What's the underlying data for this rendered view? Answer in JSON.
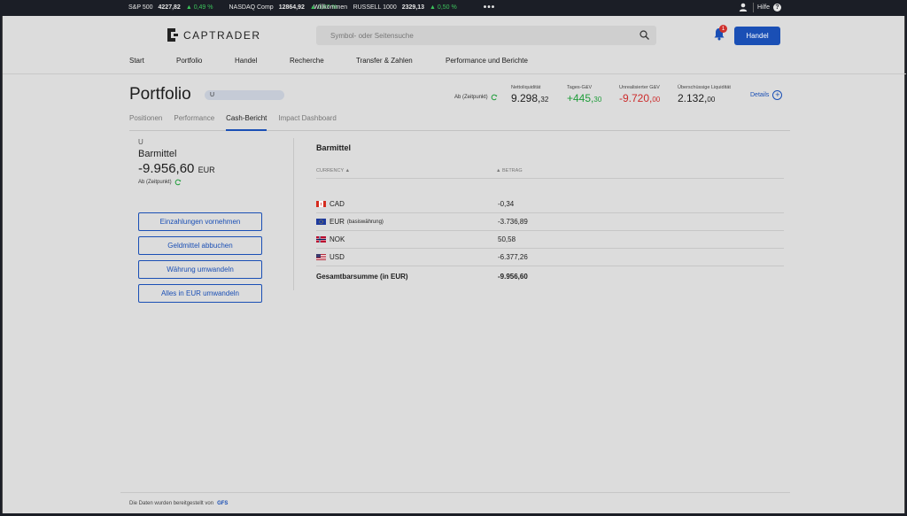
{
  "ticker": {
    "items": [
      {
        "name": "S&P 500",
        "value": "4227,82",
        "change": "▲ 0,49 %"
      },
      {
        "name": "NASDAQ Comp",
        "value": "12864,92",
        "change": "▲ 0,67 %"
      },
      {
        "name": "RUSSELL 1000",
        "value": "2329,13",
        "change": "▲ 0,50 %"
      }
    ],
    "more": "•••",
    "welcome": "Willkommen",
    "help": "Hilfe",
    "help_icon": "?"
  },
  "header": {
    "logo": "CAPTRADER",
    "search_placeholder": "Symbol- oder Seitensuche",
    "notifications_count": "1",
    "trade_button": "Handel"
  },
  "nav": [
    "Start",
    "Portfolio",
    "Handel",
    "Recherche",
    "Transfer & Zahlen",
    "Performance und Berichte"
  ],
  "portfolio": {
    "title": "Portfolio",
    "account": "U",
    "as_of": "Ab (Zeitpunkt)",
    "metrics": [
      {
        "label": "Nettoliquidität",
        "main": "9.298,",
        "cents": "32",
        "tone": "neutral"
      },
      {
        "label": "Tages-G&V",
        "main": "+445,",
        "cents": "30",
        "tone": "green"
      },
      {
        "label": "Unrealisierter G&V",
        "main": "-9.720,",
        "cents": "00",
        "tone": "red"
      },
      {
        "label": "Überschüssige Liquidität",
        "main": "2.132,",
        "cents": "00",
        "tone": "neutral"
      }
    ],
    "details": "Details",
    "details_icon": "+"
  },
  "tabs": [
    "Positionen",
    "Performance",
    "Cash-Bericht",
    "Impact Dashboard"
  ],
  "active_tab": "Cash-Bericht",
  "cash_panel": {
    "account": "U",
    "title": "Barmittel",
    "amount": "-9.956,60",
    "currency": "EUR",
    "as_of": "Ab (Zeitpunkt)",
    "actions": [
      "Einzahlungen vornehmen",
      "Geldmittel abbuchen",
      "Währung umwandeln",
      "Alles in EUR umwandeln"
    ]
  },
  "cash_table": {
    "title": "Barmittel",
    "col_currency": "CURRENCY",
    "col_amount": "BETRAG",
    "sort_arrow": "▲",
    "rows": [
      {
        "flag": "CA",
        "currency": "CAD",
        "note": "",
        "amount": "-0,34"
      },
      {
        "flag": "EU",
        "currency": "EUR",
        "note": "(basiswährung)",
        "amount": "-3.736,89"
      },
      {
        "flag": "NO",
        "currency": "NOK",
        "note": "",
        "amount": "50,58"
      },
      {
        "flag": "US",
        "currency": "USD",
        "note": "",
        "amount": "-6.377,26"
      }
    ],
    "total_label": "Gesamtbarsumme (in EUR)",
    "total_amount": "-9.956,60"
  },
  "footer": {
    "text": "Die Daten wurden bereitgestellt von",
    "provider": "GFS"
  },
  "colors": {
    "accent": "#1a4fb5",
    "positive": "#1f9d3a",
    "negative": "#cc2b2b",
    "ticker_positive": "#3cc45c"
  }
}
